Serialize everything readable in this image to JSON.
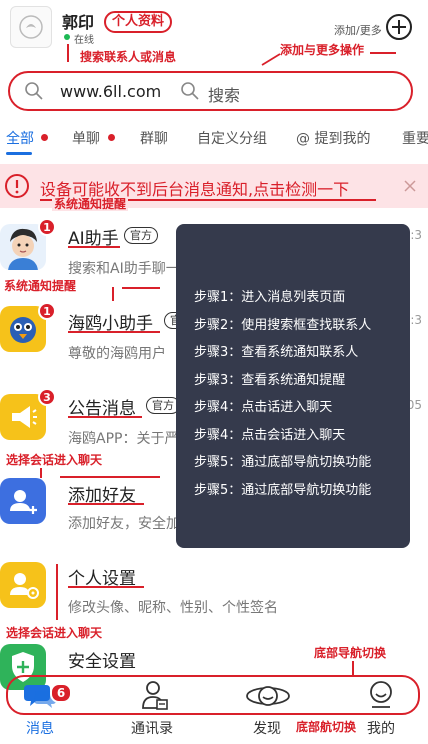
{
  "header": {
    "username": "郭印",
    "status": "在线",
    "add_more_label": "添加/更多"
  },
  "search": {
    "url_text": "www.6ll.com",
    "placeholder": "搜索"
  },
  "tabs": [
    {
      "label": "全部",
      "has_dot": true,
      "active": true
    },
    {
      "label": "单聊",
      "has_dot": true,
      "active": false
    },
    {
      "label": "群聊",
      "has_dot": false,
      "active": false
    },
    {
      "label": "自定义分组",
      "has_dot": false,
      "active": false
    },
    {
      "label": "@ 提到我的",
      "has_dot": false,
      "active": false
    },
    {
      "label": "重要",
      "has_dot": false,
      "active": false
    }
  ],
  "banner": {
    "text": "设备可能收不到后台消息通知,点击检测一下"
  },
  "conversations": [
    {
      "title": "AI助手",
      "tag": "官方",
      "subtitle": "搜索和AI助手聊一聊吧",
      "time": "下午 01:3",
      "badge": "1",
      "icon": "ai-assistant-avatar"
    },
    {
      "title": "海鸥小助手",
      "tag": "官方",
      "subtitle": "尊敬的海鸥用户",
      "time": "下午 01:3",
      "badge": "1",
      "icon": "seagull-assistant-avatar"
    },
    {
      "title": "公告消息",
      "tag": "官方",
      "subtitle": "海鸥APP：关于严",
      "time": "上午 11:05",
      "badge": "3",
      "icon": "megaphone-icon"
    },
    {
      "title": "添加好友",
      "tag": "",
      "subtitle": "添加好友，安全加密",
      "time": "",
      "badge": "",
      "icon": "add-user-icon"
    },
    {
      "title": "个人设置",
      "tag": "",
      "subtitle": "修改头像、昵称、性别、个性签名",
      "time": "",
      "badge": "",
      "icon": "user-settings-icon"
    },
    {
      "title": "安全设置",
      "tag": "",
      "subtitle": "",
      "time": "",
      "badge": "",
      "icon": "shield-plus-icon"
    }
  ],
  "steps": [
    "步骤1：进入消息列表页面",
    "步骤2：使用搜索框查找联系人",
    "步骤3：查看系统通知联系人",
    "步骤3：查看系统通知提醒",
    "步骤4：点击话进入聊天",
    "步骤4：点击会话进入聊天",
    "步骤5：通过底部导航切换功能",
    "步骤5：通过底部导航切换功能"
  ],
  "annotations": {
    "personal_info": "个人资料",
    "search_contacts": "搜索联系人或消息",
    "add_more_ops": "添加与更多操作",
    "system_notice_1": "系统通知提醒",
    "system_notice_2": "系统通知提醒",
    "select_chat_1": "选择会话进入聊天",
    "select_chat_2": "选择会话进入聊天",
    "bottom_nav_1": "底部导航切换",
    "bottom_nav_2": "底部航切换"
  },
  "bottom_nav": {
    "items": [
      {
        "label": "消息",
        "icon": "chat-bubble-icon",
        "badge": "6",
        "active": true
      },
      {
        "label": "通讯录",
        "icon": "contacts-icon",
        "badge": "",
        "active": false
      },
      {
        "label": "发现",
        "icon": "planet-icon",
        "badge": "",
        "active": false
      },
      {
        "label": "我的",
        "icon": "smiley-user-icon",
        "badge": "",
        "active": false
      }
    ]
  },
  "colors": {
    "accent": "#1b6fe0",
    "annotation_red": "#d9202a",
    "overlay_bg": "#353a4c",
    "banner_bg": "#fde3e6"
  }
}
